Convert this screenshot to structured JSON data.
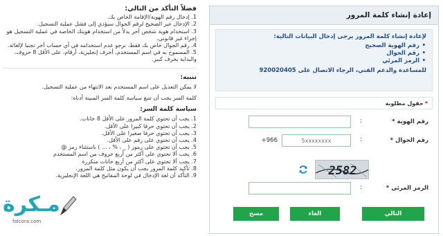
{
  "form": {
    "header_title": "إعادة إنشاء كلمة المرور",
    "info": {
      "intro": "لإعادة إنشاء كلمة المرور يرجى إدخال البيانات التالية:",
      "items": [
        "رقم الهوية الصحيح",
        "رقم الجوال",
        "الرمز المرئي"
      ],
      "contact": "للمساعدة والدعم الفني، الرجاء الاتصال على 920020405"
    },
    "required_label": "حقول مطلوبة",
    "required_star": "*",
    "id_label": "رقم الهوية *",
    "id_value": "",
    "mobile_label": "رقم الجوال *",
    "mobile_prefix": "+966",
    "mobile_placeholder": "5xxxxxxxx",
    "captcha_text": "2582",
    "captcha_label": "الرمز المرئي *",
    "captcha_value": "",
    "separator": ":",
    "buttons": {
      "next": "التالي",
      "cancel": "الغاء",
      "clear": "مسح"
    }
  },
  "instructions": {
    "title": "فضلاً التأكد من التالي:",
    "items": [
      "1. إدخال رقم الهوية/الإقامة الخاص بك.",
      "2. الإدخال غير الصحيح لرقم الجوال سيؤدي إلى فشل عملية التسجيل.",
      "3. استخدام هوية شخص آخر بدلاً من استخدام هويتك الخاصة في عملية التسجيل هو إجراء غير قانوني.",
      "4. رقم الجوال خاص بك فقط، نرجو عدم استخدامه في أي حساب آخر تجنبا لإلغائه.",
      "5. المسموح به في اسم المستخدم، أحرف إنجليزية، أرقام، على الأقل 8 حروف، والبداية بحرف كبير."
    ],
    "notice_title": "تنبيه:",
    "notice_text": "لا يمكن التعديل على اسم المستخدم بعد الانتهاء من عملية التسجيل.",
    "password_note": "كلمة السر يجب أن تتبع سياسة كلمة السر المبينة أدناه:",
    "policy_title": "سياسة كلمة السر:",
    "policy_items": [
      "1. يجب أن تحتوي كلمة المرور على الأقل 8 خانات.",
      "2. يجب أن تحتوي حرفا كبيرا على الأقل.",
      "3. يجب أن تحتوي حرفا صغيرا على الأقل.",
      "4. يجب أن تحتوي على رقم على الأقل.",
      "5. يجب أن تحتوي على رموز ( _ ، % ، ... ) باستثناء رمز @",
      "6. يجب ألا تحتوي على أكثر من أربع حروف من اسم المستخدم",
      "7. يجب ألا تحتوي على أكثر من أربع خانات متكررة",
      "8. تأكيد كلمة المرور يجب أن يكون مثل كلمة المرور.",
      "9. التأكد أن لغة الإدخال في لوحة المفاتيح هي اللغة الإنجليزية."
    ]
  },
  "watermark": {
    "text": "مـكرة",
    "url": "folcora.com"
  },
  "colors": {
    "accent_green": "#22a54a",
    "info_blue": "#1f4e8c",
    "header_bg": "#e9eef3",
    "input_border": "#93c9a0",
    "watermark": "#1fa7b8"
  }
}
